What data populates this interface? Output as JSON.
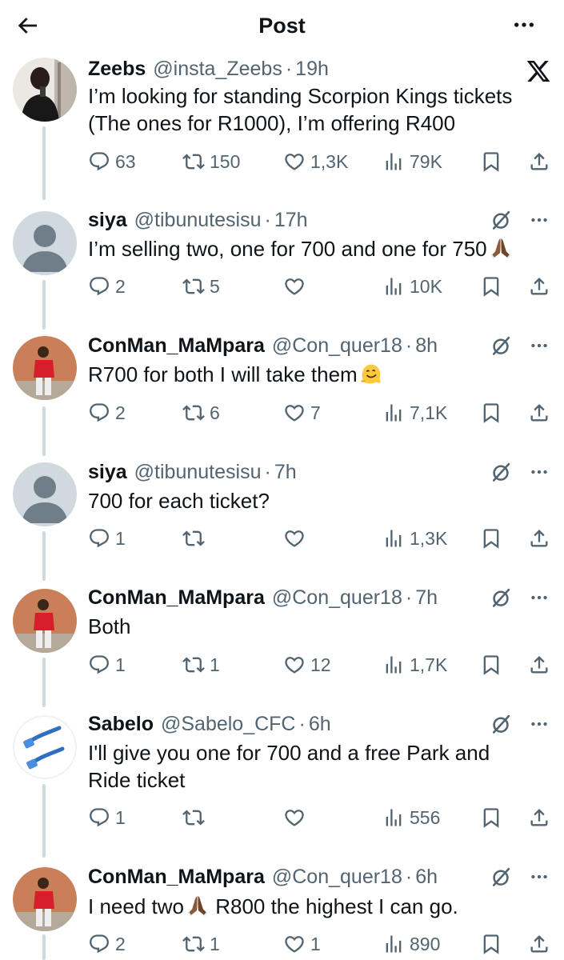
{
  "header": {
    "title": "Post"
  },
  "tweets": [
    {
      "name": "Zeebs",
      "handle": "@insta_Zeebs",
      "time": "19h",
      "text": "I’m looking for standing Scorpion Kings tickets (The ones for R1000), I’m offering R400",
      "replies": "63",
      "retweets": "150",
      "likes": "1,3K",
      "views": "79K"
    },
    {
      "name": "siya",
      "handle": "@tibunutesisu",
      "time": "17h",
      "text": "I’m selling two, one for 700 and one for 750",
      "replies": "2",
      "retweets": "5",
      "likes": "",
      "views": "10K"
    },
    {
      "name": "ConMan_MaMpara",
      "handle": "@Con_quer18",
      "time": "8h",
      "text": "R700 for both I will take them",
      "replies": "2",
      "retweets": "6",
      "likes": "7",
      "views": "7,1K"
    },
    {
      "name": "siya",
      "handle": "@tibunutesisu",
      "time": "7h",
      "text": "700 for each ticket?",
      "replies": "1",
      "retweets": "",
      "likes": "",
      "views": "1,3K"
    },
    {
      "name": "ConMan_MaMpara",
      "handle": "@Con_quer18",
      "time": "7h",
      "text": "Both",
      "replies": "1",
      "retweets": "1",
      "likes": "12",
      "views": "1,7K"
    },
    {
      "name": "Sabelo",
      "handle": "@Sabelo_CFC",
      "time": "6h",
      "text": "I'll give you one for 700 and a free Park and Ride ticket",
      "replies": "1",
      "retweets": "",
      "likes": "",
      "views": "556"
    },
    {
      "name": "ConMan_MaMpara",
      "handle": "@Con_quer18",
      "time": "6h",
      "text_before": "I need two",
      "text_after": " R800 the highest I can go.",
      "replies": "2",
      "retweets": "1",
      "likes": "1",
      "views": "890"
    }
  ],
  "icons": {
    "back": "arrow-left-icon",
    "more": "more-horizontal-icon",
    "x_logo": "x-logo-icon",
    "reply": "reply-icon",
    "retweet": "retweet-icon",
    "like": "heart-icon",
    "views": "views-icon",
    "bookmark": "bookmark-icon",
    "share": "share-icon",
    "grok": "grok-icon",
    "praying": "praying-hands-emoji",
    "melting": "melting-face-emoji"
  },
  "colors": {
    "text": "#0f1419",
    "secondary": "#536471",
    "thread_line": "#cfd9de",
    "background": "#ffffff"
  }
}
